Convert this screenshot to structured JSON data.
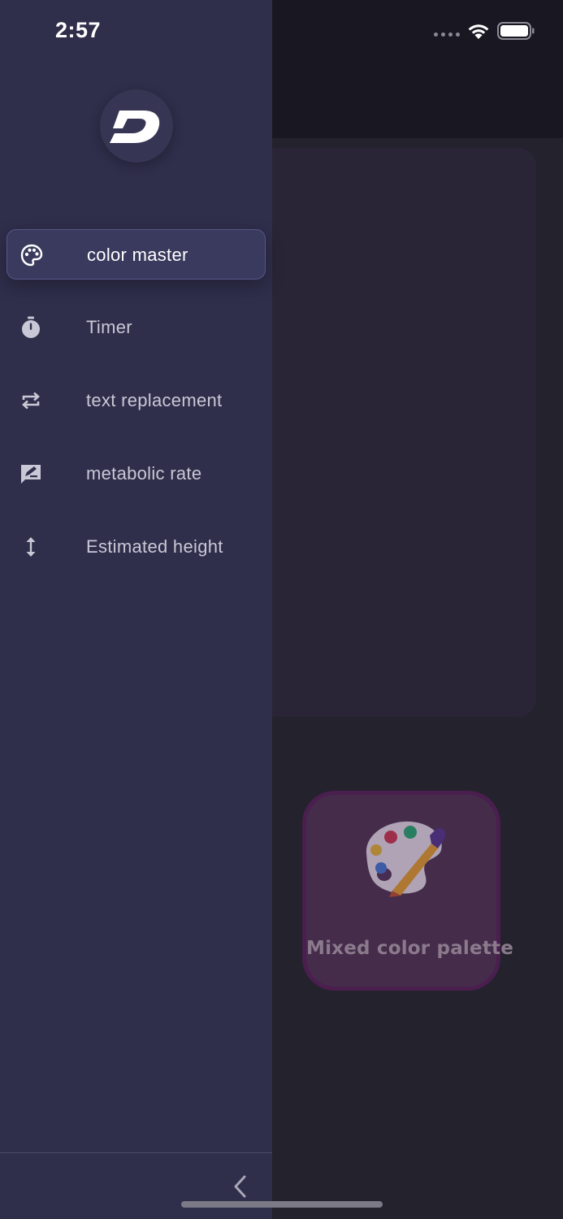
{
  "status_bar": {
    "time": "2:57",
    "icons": [
      "signal-dots-icon",
      "wifi-icon",
      "battery-icon"
    ]
  },
  "drawer": {
    "logo_letter": "D",
    "items": [
      {
        "label": "color master",
        "icon": "palette-icon",
        "active": true
      },
      {
        "label": "Timer",
        "icon": "stopwatch-icon",
        "active": false
      },
      {
        "label": "text replacement",
        "icon": "repeat-icon",
        "active": false
      },
      {
        "label": "metabolic rate",
        "icon": "edit-chart-icon",
        "active": false
      },
      {
        "label": "Estimated height",
        "icon": "vertical-arrows-icon",
        "active": false
      }
    ],
    "collapse_icon": "chevron-left-icon"
  },
  "background": {
    "tile_label": "Mixed color palette",
    "tile_icon": "artist-palette-icon"
  },
  "colors": {
    "drawer_bg": "#2f2e4b",
    "active_item_bg": "#3a3a5e",
    "app_bg": "#23222d",
    "tile_bg": "#452c4b",
    "tile_border": "#4a1e4e"
  }
}
